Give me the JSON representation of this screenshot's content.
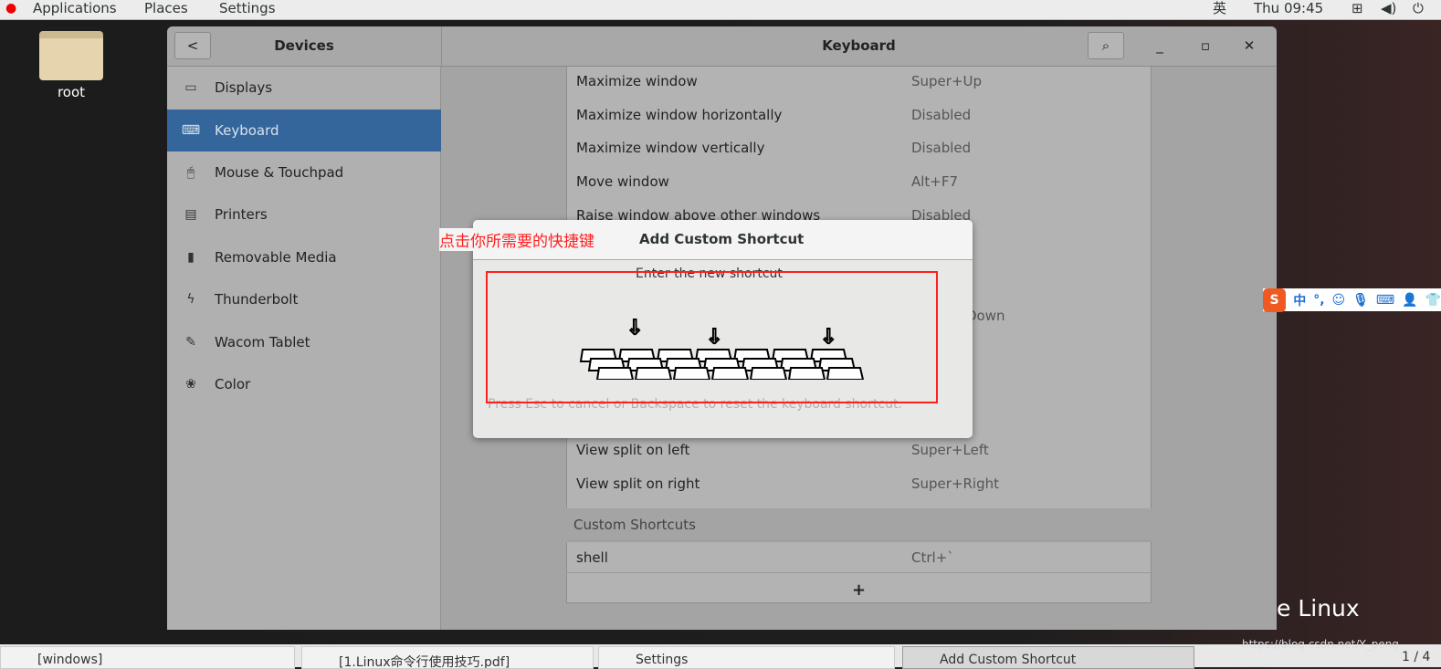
{
  "topbar": {
    "applications": "Applications",
    "places": "Places",
    "settings": "Settings",
    "input_method": "英",
    "clock": "Thu 09:45",
    "icons": [
      "redhat-logo",
      "network-icon",
      "volume-icon",
      "power-icon"
    ]
  },
  "desktop": {
    "folder_label": "root",
    "brand_text": "e Linux",
    "watermark": "https://blog.csdn.net/Y_peng"
  },
  "window": {
    "sidebar_title": "Devices",
    "title": "Keyboard",
    "sidebar": {
      "items": [
        {
          "label": "Displays",
          "icon": "display-icon"
        },
        {
          "label": "Keyboard",
          "icon": "keyboard-icon",
          "active": true
        },
        {
          "label": "Mouse & Touchpad",
          "icon": "mouse-icon"
        },
        {
          "label": "Printers",
          "icon": "printer-icon"
        },
        {
          "label": "Removable Media",
          "icon": "usb-icon"
        },
        {
          "label": "Thunderbolt",
          "icon": "thunderbolt-icon"
        },
        {
          "label": "Wacom Tablet",
          "icon": "tablet-icon"
        },
        {
          "label": "Color",
          "icon": "color-icon"
        }
      ]
    },
    "shortcuts": [
      {
        "label": "Maximize window",
        "value": "Super+Up"
      },
      {
        "label": "Maximize window horizontally",
        "value": "Disabled"
      },
      {
        "label": "Maximize window vertically",
        "value": "Disabled"
      },
      {
        "label": "Move window",
        "value": "Alt+F7"
      },
      {
        "label": "Raise window above other windows",
        "value": "Disabled"
      },
      {
        "label": "",
        "value": "Down"
      },
      {
        "label": "View split on left",
        "value": "Super+Left"
      },
      {
        "label": "View split on right",
        "value": "Super+Right"
      }
    ],
    "custom_header": "Custom Shortcuts",
    "custom": [
      {
        "label": "shell",
        "value": "Ctrl+`"
      }
    ],
    "add_label": "+"
  },
  "dialog": {
    "title": "Add Custom Shortcut",
    "annotation": "点击你所需要的快捷键",
    "prompt": "Enter the new shortcut",
    "hint": "Press Esc to cancel or Backspace to reset the keyboard shortcut.",
    "annotation_color": "#ff2020"
  },
  "ime": {
    "icons": [
      "sogou-logo",
      "chinese-mode-icon",
      "punctuation-icon",
      "emoji-icon",
      "microphone-icon",
      "keyboard-icon",
      "user-icon",
      "skin-icon"
    ],
    "mode": "中",
    "punct": "°,"
  },
  "taskbar": {
    "items": [
      {
        "label": "[windows]"
      },
      {
        "label": "[1.Linux命令行使用技巧.pdf]"
      },
      {
        "label": "Settings"
      },
      {
        "label": "Add Custom Shortcut",
        "active": true
      }
    ],
    "pager": "1 / 4"
  }
}
